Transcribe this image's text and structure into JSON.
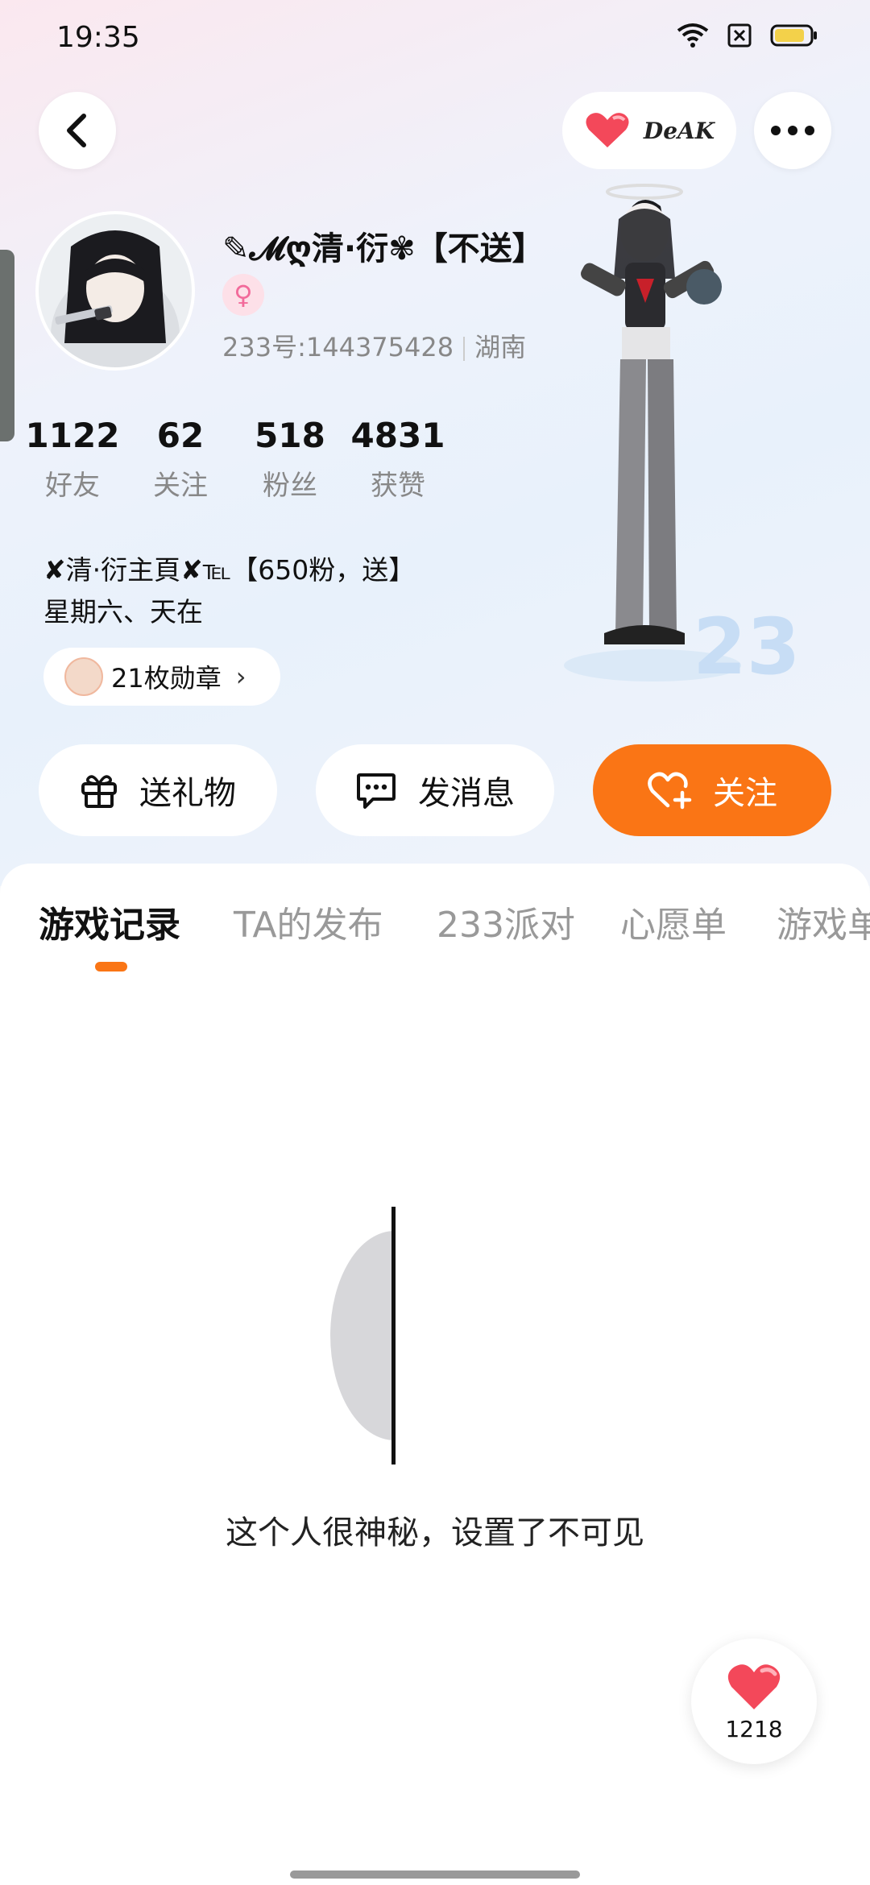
{
  "status_bar": {
    "time": "19:35"
  },
  "header": {
    "badge_text": "DeAK"
  },
  "profile": {
    "name": "✎𝓜ღ清·衍✾【不送】",
    "gender_symbol": "♀",
    "id_text": "233号:144375428",
    "location": "湖南",
    "stats": [
      {
        "value": "1122",
        "label": "好友"
      },
      {
        "value": "62",
        "label": "关注"
      },
      {
        "value": "518",
        "label": "粉丝"
      },
      {
        "value": "4831",
        "label": "获赞"
      }
    ],
    "bio_line1": "✘清·衍主頁✘℡【650粉，送】",
    "bio_line2": "星期六、天在",
    "medals_label": "21枚勋章",
    "medals_chevron": "›"
  },
  "actions": {
    "gift_label": "送礼物",
    "message_label": "发消息",
    "follow_label": "关注"
  },
  "tabs": [
    {
      "label": "游戏记录",
      "active": true
    },
    {
      "label": "TA的发布",
      "active": false
    },
    {
      "label": "233派对",
      "active": false
    },
    {
      "label": "心愿单",
      "active": false
    },
    {
      "label": "游戏单",
      "active": false
    }
  ],
  "empty_state": {
    "message": "这个人很神秘，设置了不可见"
  },
  "like_fab": {
    "count": "1218"
  },
  "colors": {
    "accent": "#fa7515",
    "heart": "#f3485a"
  }
}
